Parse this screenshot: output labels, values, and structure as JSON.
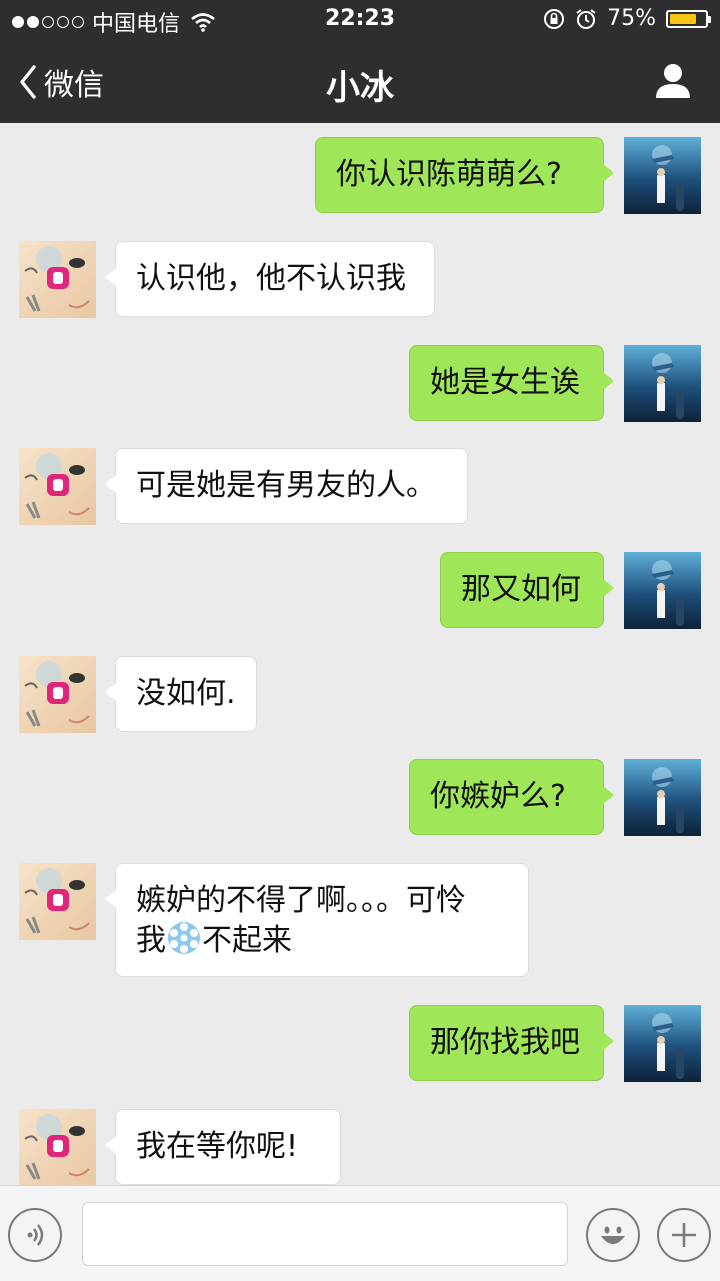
{
  "status_bar": {
    "carrier": "中国电信",
    "time": "22:23",
    "battery": "75%",
    "battery_level": 0.75,
    "signal_strength": 2,
    "icons": [
      "wifi-icon",
      "rotation-lock-icon",
      "alarm-icon",
      "battery-icon"
    ]
  },
  "nav": {
    "back_label": "微信",
    "title": "小冰",
    "right_icon": "person-icon"
  },
  "messages": [
    {
      "sender": "me",
      "text": "你认识陈萌萌么?"
    },
    {
      "sender": "them",
      "text": "认识他，他不认识我"
    },
    {
      "sender": "me",
      "text": "她是女生诶"
    },
    {
      "sender": "them",
      "text": "可是她是有男友的人。"
    },
    {
      "sender": "me",
      "text": "那又如何"
    },
    {
      "sender": "them",
      "text": "没如何."
    },
    {
      "sender": "me",
      "text": "你嫉妒么?"
    },
    {
      "sender": "them",
      "line1": "嫉妒的不得了啊。。。可怜",
      "line2_before": "我",
      "line2_after": "不起来",
      "inline_icon": "snowflake-emoji-icon"
    },
    {
      "sender": "me",
      "text": "那你找我吧"
    },
    {
      "sender": "them",
      "text": "我在等你呢!"
    }
  ],
  "input_bar": {
    "voice_icon": "voice-icon",
    "emoji_icon": "emoji-icon",
    "more_icon": "plus-icon",
    "input_value": ""
  },
  "colors": {
    "bar": "#2e2e30",
    "chat_bg": "#ebebeb",
    "my_bubble": "#9fe658",
    "their_bubble": "#ffffff",
    "battery_fill": "#f5c518"
  }
}
